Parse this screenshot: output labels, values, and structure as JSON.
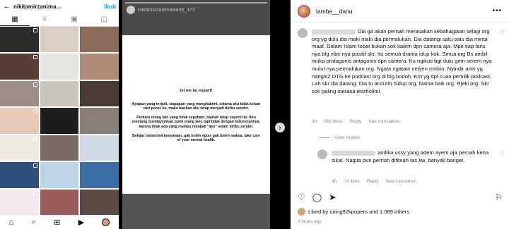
{
  "left_panel": {
    "back_icon": "back-arrow-icon",
    "username": "nikitamirzanima…",
    "follow_label": "Ikuti",
    "tabs": [
      "grid-icon",
      "crown-icon",
      "reels-icon",
      "tagged-icon"
    ],
    "grid_colors": [
      "#2b2b2b",
      "#d9cfc4",
      "#8b6a5a",
      "#5a3e36",
      "#e8e6e3",
      "#b08c78",
      "#9c8d88",
      "#c9c3bd",
      "#4a3a35",
      "#e7c9b5",
      "#1d1d1d",
      "#8a7f78",
      "#efe9e4",
      "#7a6a65",
      "#cfd9e4",
      "#2f4e7a",
      "#bcd3e8",
      "#3e6fa8",
      "#f2eaea",
      "#9b5b5b",
      "#5b4a44"
    ],
    "nav_icons": [
      "home-icon",
      "search-icon",
      "add-icon",
      "reels-icon",
      "profile-icon"
    ]
  },
  "story": {
    "username": "nikitamirzanimawardi_172",
    "sub": "",
    "title": "let me be myself!",
    "paragraphs": [
      "Apapun yang terjadi, siapapun yang menghakimi, selama aku tidak keluar dari poros ku, maka biarkan aku tetap menjadi diriku sendiri.",
      "Perkara orang lain yang tidak sepaham, biarlah tetap seperti itu. Aku memang membutuhkan opini orang lain, tapi tidak dengan kebenciannya. karena tidak ada yang mampu menjadi \"aku\" selain diriku sendiri.",
      "Belajar menerima kenyataan, gak boleh egois gak boleh maksa, take care of your mental health."
    ]
  },
  "post": {
    "username": "lambe__danu",
    "more_icon": "more-dots-icon",
    "comments": [
      {
        "text": "Dia ga akan pernah merasakan kebahagiaan selagi org org yg dulu dia maki maki dia permalukan. Dia datangi satu satu dia minta maaf. Dalam Islam tobat bukan sok kalem dpn camera aja. Mpe tiap fans nya blg vibe nya positif skr. Itu semua drama idup kok. Smua org Bs ambil muka protagonis antagonis dpn camera. Ku ngikuti bgt dulu gmn serem nya mulut nya permalukan org. Ngata ngatain netijen miskin. Nyindir artis yg nangis2 DTG ke podcast org di blg bodoh. Krn yg dpt cuan pemilik podcast. Lah skr dia datang. Dia tu ancurin hidup org. Nama baik org. Rjeki org. Skr sok paling merasa terzholimi.",
        "time": "3h",
        "likes": "362 likes",
        "reply": "Reply",
        "translate": "See translation"
      },
      {
        "text": "andika ussy yang adem ayem aja pernah kena sikat. Nagita pun pernah difitnah tas kw, banyak banget.",
        "time": "3h",
        "likes": "73 likes",
        "reply": "Reply",
        "translate": "See translation"
      }
    ],
    "view_replies": "View replies",
    "actions": [
      "heart-icon",
      "comment-icon",
      "share-icon",
      "bookmark-icon"
    ],
    "liked_by": "Liked by iuting92kpopers and 1.089 others",
    "posted": "3 hours ago"
  },
  "next_icon": "chevron-right-icon",
  "next_label": "›"
}
